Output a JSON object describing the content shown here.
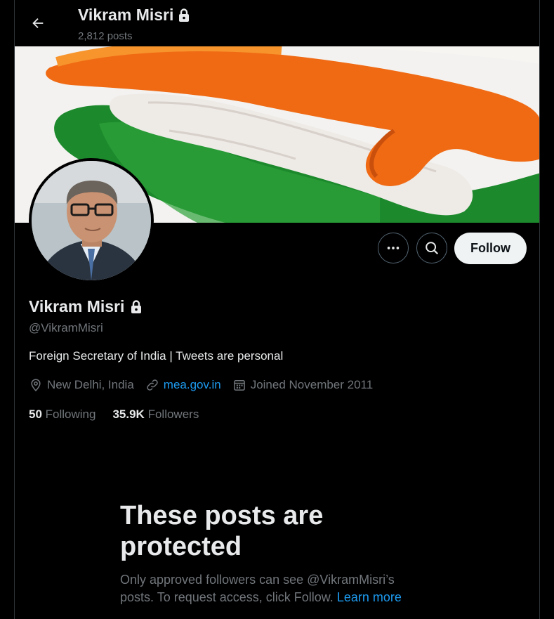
{
  "header": {
    "back_icon": "arrow-left-icon",
    "name": "Vikram Misri",
    "lock_icon": "lock-icon",
    "posts_count": "2,812 posts"
  },
  "actions": {
    "more_icon": "more-horizontal-icon",
    "search_icon": "search-icon",
    "follow_label": "Follow"
  },
  "profile": {
    "name": "Vikram Misri",
    "handle": "@VikramMisri",
    "bio": "Foreign Secretary of India | Tweets are personal",
    "location": "New Delhi, India",
    "website": "mea.gov.in",
    "joined": "Joined November 2011",
    "following_count": "50",
    "following_label": "Following",
    "followers_count": "35.9K",
    "followers_label": "Followers"
  },
  "protected": {
    "title": "These posts are protected",
    "text": "Only approved followers can see @VikramMisri’s posts. To request access, click Follow.",
    "link": "Learn more"
  },
  "colors": {
    "background": "#000000",
    "text": "#e7e9ea",
    "muted": "#71767b",
    "link": "#1d9bf0",
    "follow_bg": "#eff3f4"
  }
}
